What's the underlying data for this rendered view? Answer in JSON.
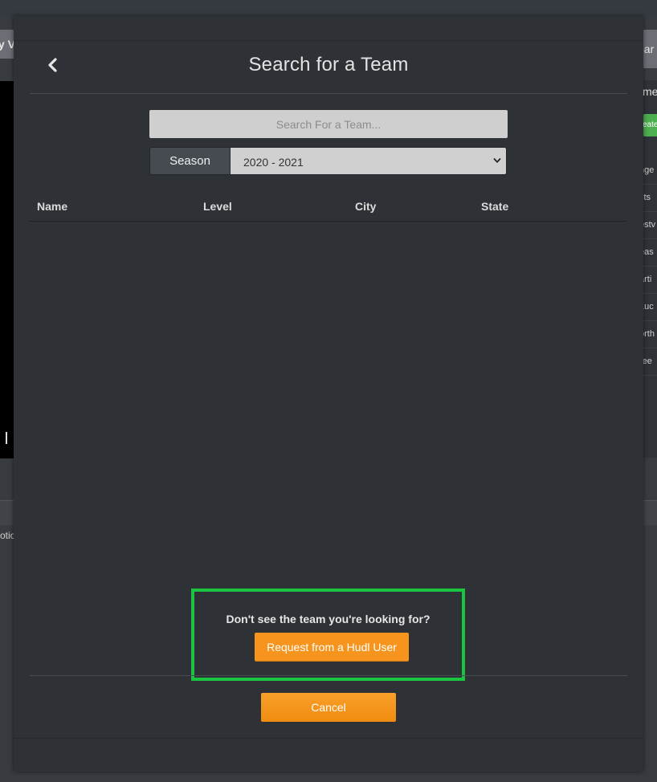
{
  "background": {
    "left_tab_text": "ly V",
    "right_tab_text": "oar",
    "right_panel_heading": "me",
    "right_button_text": "eate",
    "right_list_items": [
      "nge",
      "sts",
      "estv",
      "eas",
      "arti",
      "Luc",
      "orth",
      "ree"
    ],
    "left_lower_text": "otio"
  },
  "modal": {
    "title": "Search for a Team",
    "search": {
      "placeholder": "Search For a Team...",
      "value": ""
    },
    "season": {
      "button_label": "Season",
      "selected": "2020 - 2021"
    },
    "table": {
      "columns": [
        "Name",
        "Level",
        "City",
        "State"
      ],
      "rows": []
    },
    "notice": {
      "text": "Don't see the team you're looking for?",
      "request_label": "Request from a Hudl User",
      "highlight_color": "#19c540"
    },
    "cancel_label": "Cancel",
    "accent_color": "#f7941d"
  }
}
